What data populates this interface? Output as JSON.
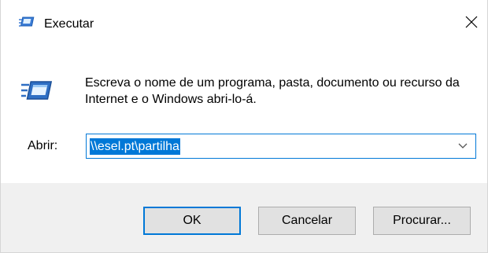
{
  "window": {
    "title": "Executar"
  },
  "dialog": {
    "description": "Escreva o nome de um programa, pasta, documento ou recurso da Internet e o Windows abri-lo-á.",
    "open_label": "Abrir:",
    "open_value": "\\\\esel.pt\\partilha"
  },
  "buttons": {
    "ok": "OK",
    "cancel": "Cancelar",
    "browse": "Procurar..."
  },
  "icons": {
    "title_icon": "run-icon",
    "dialog_icon": "run-icon",
    "close_icon": "close-icon",
    "dropdown_icon": "chevron-down-icon"
  },
  "colors": {
    "accent": "#0078d7",
    "footer_bg": "#f0f0f0",
    "button_bg": "#e1e1e1"
  }
}
